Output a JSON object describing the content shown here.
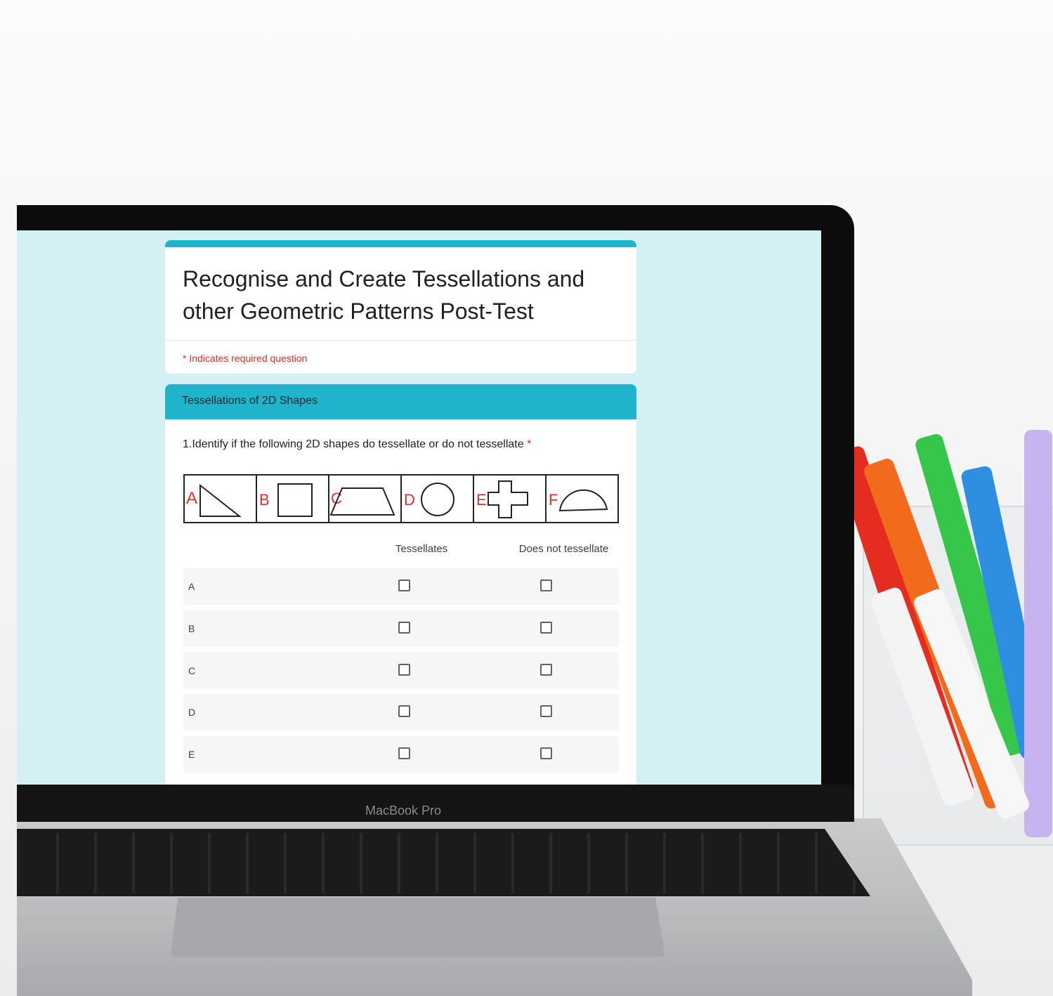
{
  "device": {
    "brand_label": "MacBook Pro"
  },
  "form": {
    "title": "Recognise and Create Tessellations and other Geometric Patterns Post-Test",
    "required_note": "* Indicates required question",
    "accent_color": "#1fb3cc",
    "section": {
      "title": "Tessellations of 2D Shapes",
      "question": {
        "text": "1.Identify if the following 2D shapes do tessellate or do not tessellate",
        "required_mark": "*",
        "shape_labels": [
          "A",
          "B",
          "C",
          "D",
          "E",
          "F"
        ],
        "columns": [
          "Tessellates",
          "Does not tessellate"
        ],
        "rows": [
          "A",
          "B",
          "C",
          "D",
          "E"
        ]
      }
    }
  }
}
